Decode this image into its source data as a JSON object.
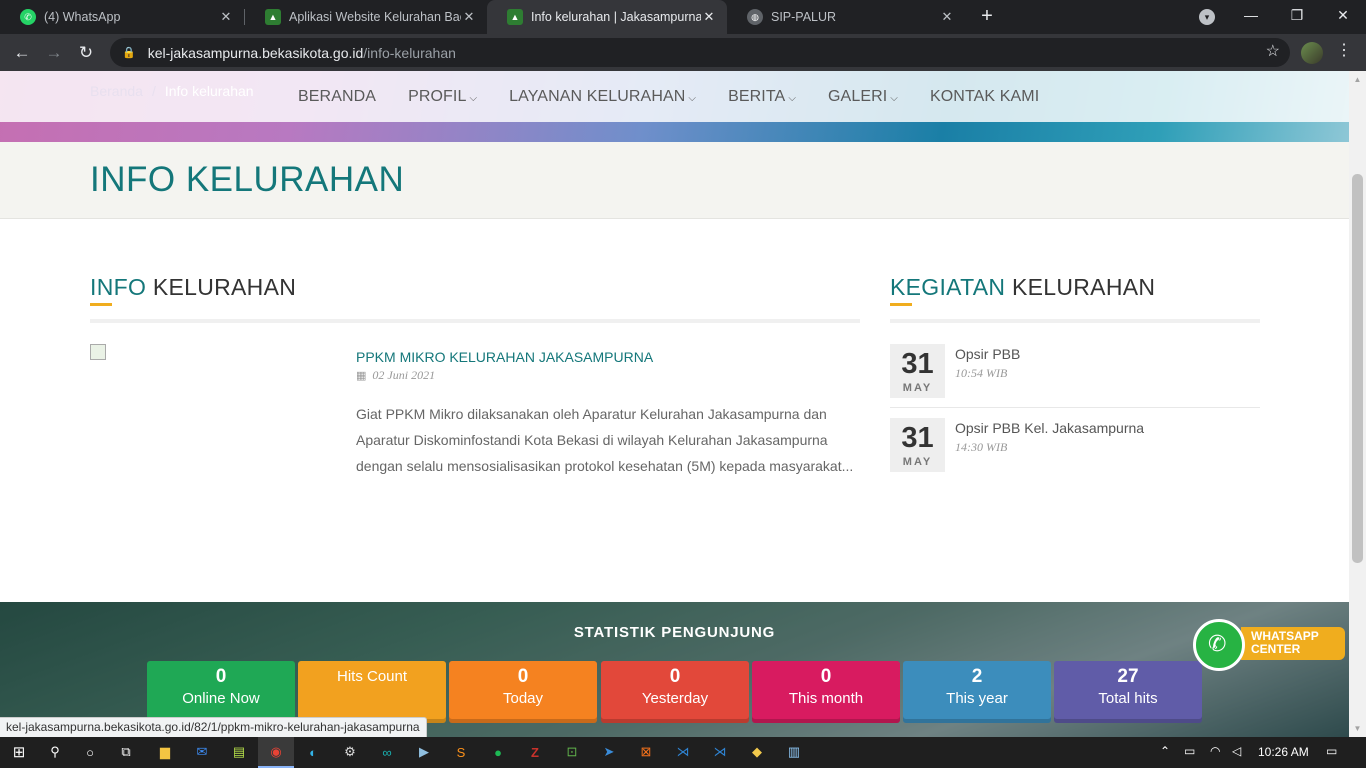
{
  "browser": {
    "tabs": [
      {
        "title": "(4) WhatsApp",
        "icon": "whatsapp-icon",
        "active": false
      },
      {
        "title": "Aplikasi Website Kelurahan Backe",
        "icon": "bekasi-crest-icon",
        "active": false
      },
      {
        "title": "Info kelurahan | Jakasampurna",
        "icon": "bekasi-crest-icon",
        "active": true
      },
      {
        "title": "SIP-PALUR",
        "icon": "globe-icon",
        "active": false
      }
    ],
    "url_host": "kel-jakasampurna.bekasikota.go.id",
    "url_path": "/info-kelurahan",
    "status_url": "kel-jakasampurna.bekasikota.go.id/82/1/ppkm-mikro-kelurahan-jakasampurna"
  },
  "breadcrumb": {
    "home": "Beranda",
    "separator": "/",
    "current": "Info kelurahan"
  },
  "nav": {
    "items": [
      {
        "label": "BERANDA",
        "dropdown": false
      },
      {
        "label": "PROFIL",
        "dropdown": true
      },
      {
        "label": "LAYANAN KELURAHAN",
        "dropdown": true
      },
      {
        "label": "BERITA",
        "dropdown": true
      },
      {
        "label": "GALERI",
        "dropdown": true
      },
      {
        "label": "KONTAK KAMI",
        "dropdown": false
      }
    ]
  },
  "page_title": "INFO KELURAHAN",
  "info_section": {
    "heading_accent": "INFO",
    "heading_rest": " KELURAHAN",
    "post": {
      "title": "PPKM MIKRO KELURAHAN JAKASAMPURNA",
      "date": "02 Juni 2021",
      "excerpt": "Giat PPKM Mikro dilaksanakan oleh Aparatur Kelurahan Jakasampurna dan Aparatur Diskominfostandi Kota Bekasi di wilayah Kelurahan Jakasampurna dengan selalu mensosialisasikan protokol kesehatan (5M) kepada masyarakat..."
    }
  },
  "kegiatan_section": {
    "heading_accent": "KEGIATAN",
    "heading_rest": " KELURAHAN",
    "events": [
      {
        "day": "31",
        "month": "MAY",
        "title": "Opsir PBB",
        "time": "10:54 WIB"
      },
      {
        "day": "31",
        "month": "MAY",
        "title": "Opsir PBB Kel. Jakasampurna",
        "time": "14:30 WIB"
      }
    ]
  },
  "stats": {
    "heading": "STATISTIK PENGUNJUNG",
    "items": [
      {
        "value": "0",
        "label": "Online Now",
        "color": "#1fa855"
      },
      {
        "value": "",
        "label": "Hits Count",
        "color": "#f2a11f"
      },
      {
        "value": "0",
        "label": "Today",
        "color": "#f58220"
      },
      {
        "value": "0",
        "label": "Yesterday",
        "color": "#e2483a"
      },
      {
        "value": "0",
        "label": "This month",
        "color": "#d81b60"
      },
      {
        "value": "2",
        "label": "This year",
        "color": "#3c8dbc"
      },
      {
        "value": "27",
        "label": "Total hits",
        "color": "#605ca8"
      }
    ]
  },
  "whatsapp": {
    "line1": "WHATSAPP",
    "line2": "CENTER"
  },
  "taskbar": {
    "time": "10:26 AM"
  },
  "colors": {
    "teal": "#14777a",
    "accent_orange": "#f0ad1e"
  }
}
